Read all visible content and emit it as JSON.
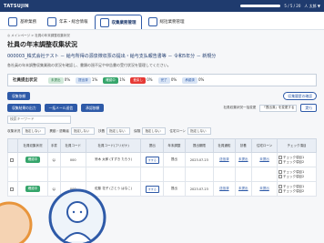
{
  "header": {
    "logo": "TATSUJIN",
    "status_text": "5 / 5 / 20",
    "user": "人 太郎 ▼"
  },
  "tabs": [
    {
      "label": "基幹業務"
    },
    {
      "label": "年末・総合情報"
    },
    {
      "label": "収集業務管理"
    },
    {
      "label": "総括業務管理"
    }
  ],
  "page": {
    "breadcrumb": "◎ メインページ > 社員の年末調整収集状況",
    "title": "社員の年末調整収集状況",
    "subtitle": "000003_株式会社テスト － 給与所得の源泉徴収票の提出・給与支払報告書等 － 令和5年分 － 新規分",
    "desc": "各社員の年末調整収集業務の状況を確認し、書類の過不足や申告書の受付状況を管理してください。"
  },
  "status": {
    "label": "社員提出状況",
    "items": [
      {
        "chip": "未提出",
        "value": "0%",
        "color": "g"
      },
      {
        "chip": "提出済",
        "value": "1%",
        "color": "b"
      },
      {
        "chip": "確認中",
        "value": "1%",
        "color": "gr"
      },
      {
        "chip": "差戻し",
        "value": "0%",
        "color": "r"
      },
      {
        "chip": "完了",
        "value": "0%",
        "color": "b"
      },
      {
        "chip": "承認済",
        "value": "0%",
        "color": "b"
      }
    ]
  },
  "actions": {
    "collect": "収集依頼",
    "export": "収集結果の出力",
    "bulk_mail": "一括メール送信",
    "approve": "承認依頼",
    "history": "収集履歴の確認",
    "status_select_label": "社員収集状況一括変更",
    "status_select": "「提出済」を変更する",
    "go": "実行"
  },
  "search": {
    "placeholder": "検索キーワード"
  },
  "filters": [
    {
      "label": "収集状況",
      "value": "指定しない"
    },
    {
      "label": "異動・退職者",
      "value": "指定しない"
    },
    {
      "label": "扶養",
      "value": "指定しない"
    },
    {
      "label": "保険",
      "value": "指定しない"
    },
    {
      "label": "住宅ローン",
      "value": "指定しない"
    }
  ],
  "table": {
    "headers": [
      "",
      "社員収集状況",
      "手書",
      "社員コード",
      "社員コード(フリガナ)",
      "提出",
      "年末調整",
      "提出期限",
      "社員通知",
      "扶養",
      "住宅ローン",
      "チェック項目"
    ],
    "rows": [
      {
        "status": "確認中",
        "code": "000",
        "name": "鈴木 太郎 (すずき たろう)",
        "submit": "すする",
        "tax": "提出",
        "date": "2023.07.23",
        "notice": "送信済",
        "dep": "未提出",
        "loan": "未提出",
        "checks": [
          "チェック項目1",
          "チェック項目2"
        ]
      },
      {
        "status": "",
        "code": "",
        "name": "",
        "submit": "",
        "tax": "",
        "date": "",
        "notice": "",
        "dep": "",
        "loan": "",
        "checks": [
          "チェック項目1",
          "チェック項目2"
        ]
      },
      {
        "status": "確認中",
        "code": "000",
        "name": "佐藤 花子 (さとう はなこ)",
        "submit": "すする",
        "tax": "提出",
        "date": "2023.07.23",
        "notice": "送信済",
        "dep": "未提出",
        "loan": "未提出",
        "checks": [
          "チェック項目1",
          "チェック項目2"
        ]
      }
    ]
  }
}
